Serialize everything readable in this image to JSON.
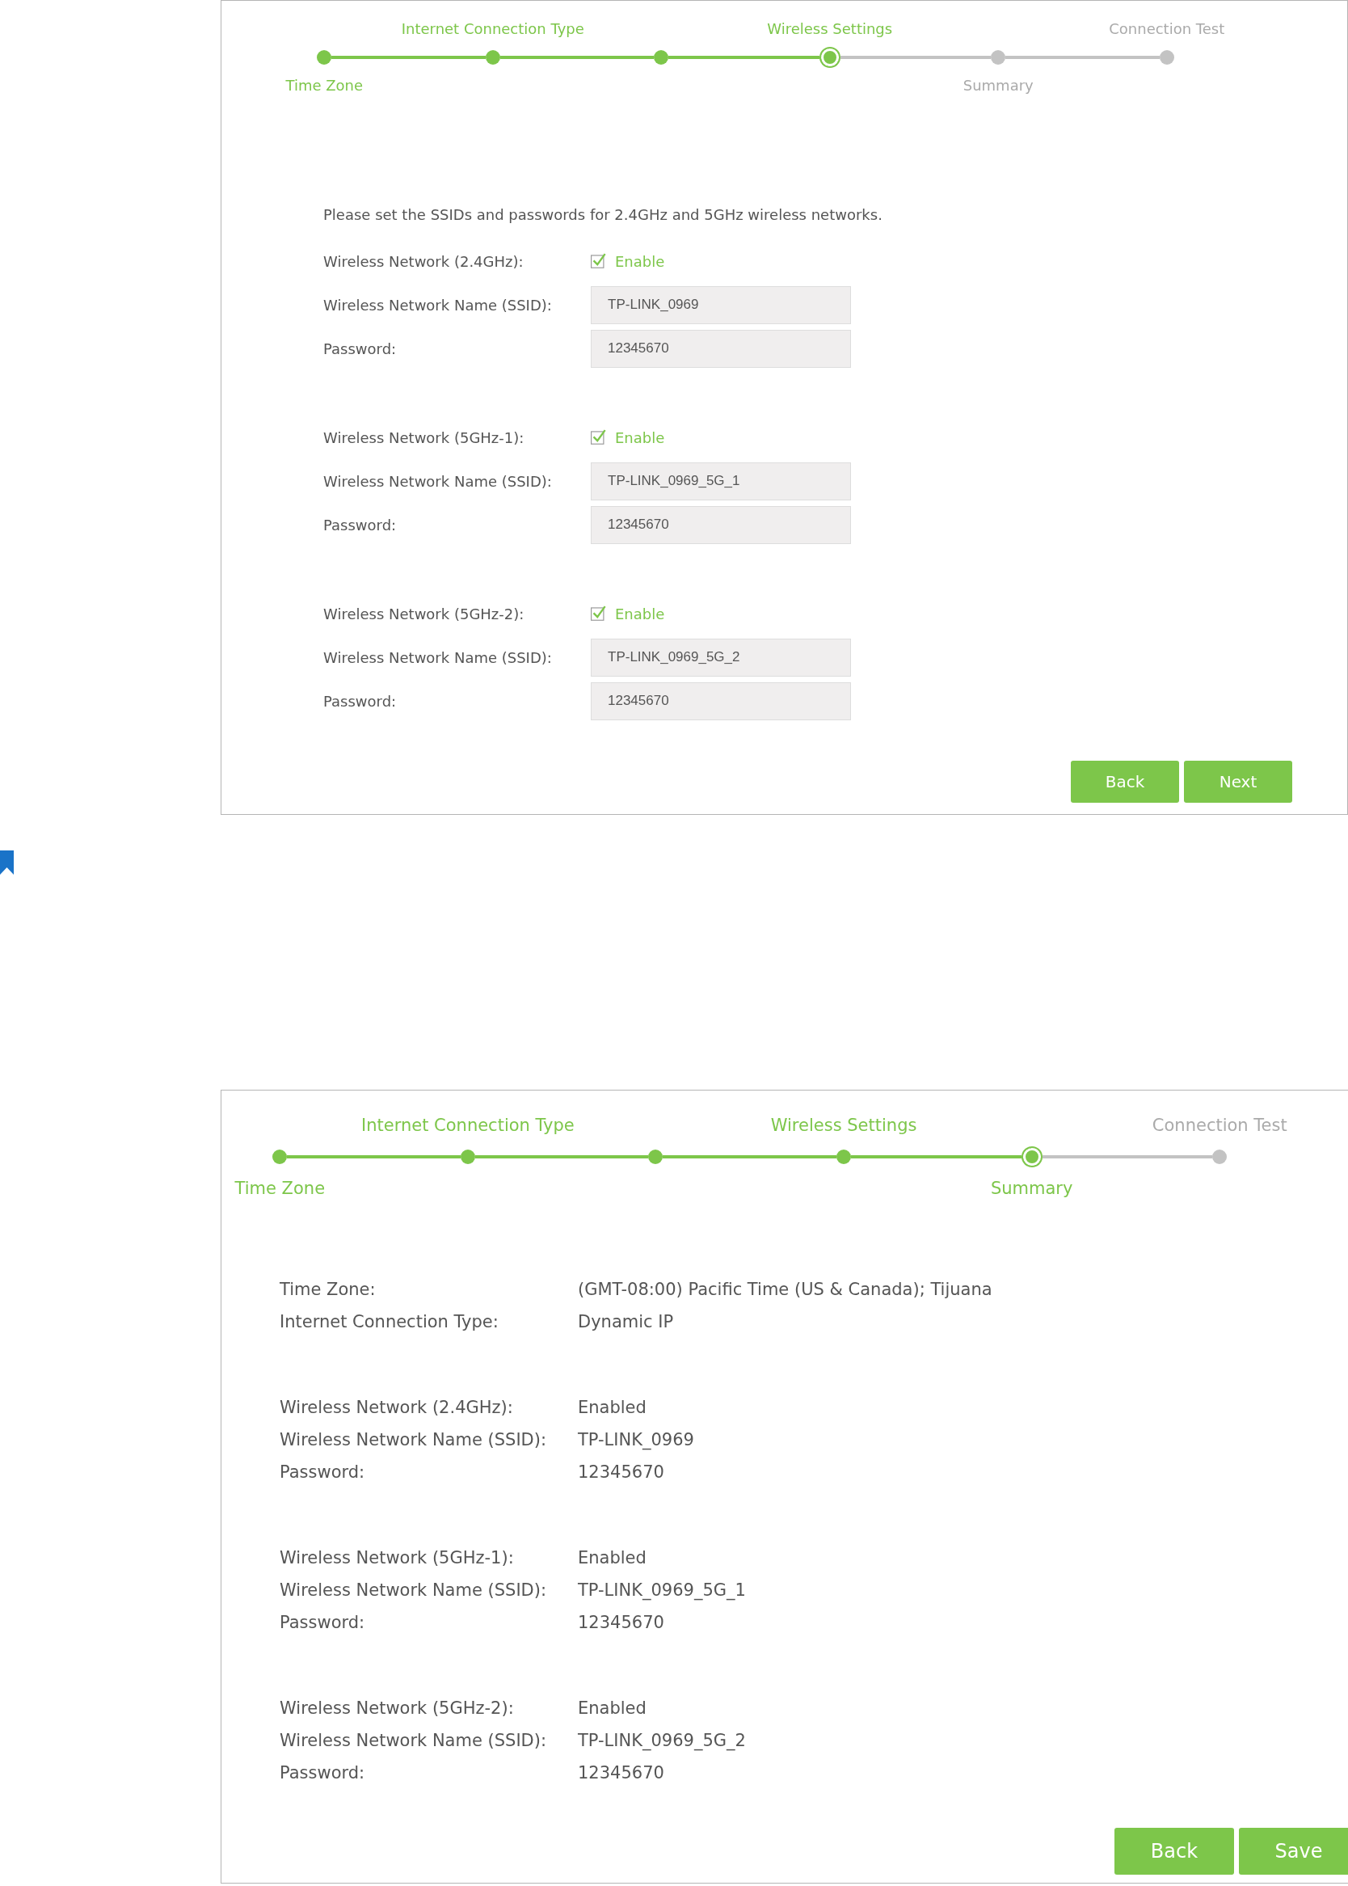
{
  "wizard_form": {
    "steps": [
      {
        "label": "Time Zone",
        "label_below": true,
        "completed": true,
        "current": false
      },
      {
        "label": "Internet Connection Type",
        "label_below": false,
        "completed": true,
        "current": false
      },
      {
        "completed": true,
        "current": false
      },
      {
        "label": "Wireless Settings",
        "label_below": false,
        "completed": false,
        "current": true
      },
      {
        "label": "Summary",
        "label_below": true,
        "completed": false,
        "current": false
      },
      {
        "label": "Connection Test",
        "label_below": false,
        "completed": false,
        "current": false
      }
    ],
    "intro": "Please set the SSIDs and passwords for 2.4GHz and 5GHz wireless networks.",
    "networks": [
      {
        "label": "Wireless Network (2.4GHz):",
        "checked": true,
        "enable_label": "Enable",
        "ssid_label": "Wireless Network Name (SSID):",
        "ssid": "TP-LINK_0969",
        "password_label": "Password:",
        "password": "12345670"
      },
      {
        "label": "Wireless Network (5GHz-1):",
        "checked": true,
        "enable_label": "Enable",
        "ssid_label": "Wireless Network Name (SSID):",
        "ssid": "TP-LINK_0969_5G_1",
        "password_label": "Password:",
        "password": "12345670"
      },
      {
        "label": "Wireless Network (5GHz-2):",
        "checked": true,
        "enable_label": "Enable",
        "ssid_label": "Wireless Network Name (SSID):",
        "ssid": "TP-LINK_0969_5G_2",
        "password_label": "Password:",
        "password": "12345670"
      }
    ],
    "buttons": [
      "Back",
      "Next"
    ]
  },
  "wizard_summary": {
    "steps": [
      {
        "label": "Time Zone",
        "label_below": true,
        "completed": true,
        "current": false
      },
      {
        "label": "Internet Connection Type",
        "label_below": false,
        "completed": true,
        "current": false
      },
      {
        "completed": true,
        "current": false
      },
      {
        "label": "Wireless Settings",
        "label_below": false,
        "completed": true,
        "current": false
      },
      {
        "label": "Summary",
        "label_below": true,
        "completed": false,
        "current": true
      },
      {
        "label": "Connection Test",
        "label_below": false,
        "completed": false,
        "current": false
      }
    ],
    "groups": [
      [
        {
          "label": "Time Zone:",
          "value": "(GMT-08:00) Pacific Time (US & Canada); Tijuana"
        },
        {
          "label": "Internet Connection Type:",
          "value": "Dynamic IP"
        }
      ],
      [
        {
          "label": "Wireless Network (2.4GHz):",
          "value": "Enabled"
        },
        {
          "label": "Wireless Network Name (SSID):",
          "value": "TP-LINK_0969"
        },
        {
          "label": "Password:",
          "value": "12345670"
        }
      ],
      [
        {
          "label": "Wireless Network (5GHz-1):",
          "value": "Enabled"
        },
        {
          "label": "Wireless Network Name (SSID):",
          "value": "TP-LINK_0969_5G_1"
        },
        {
          "label": "Password:",
          "value": "12345670"
        }
      ],
      [
        {
          "label": "Wireless Network (5GHz-2):",
          "value": "Enabled"
        },
        {
          "label": "Wireless Network Name (SSID):",
          "value": "TP-LINK_0969_5G_2"
        },
        {
          "label": "Password:",
          "value": "12345670"
        }
      ]
    ],
    "buttons": [
      "Back",
      "Save"
    ]
  }
}
